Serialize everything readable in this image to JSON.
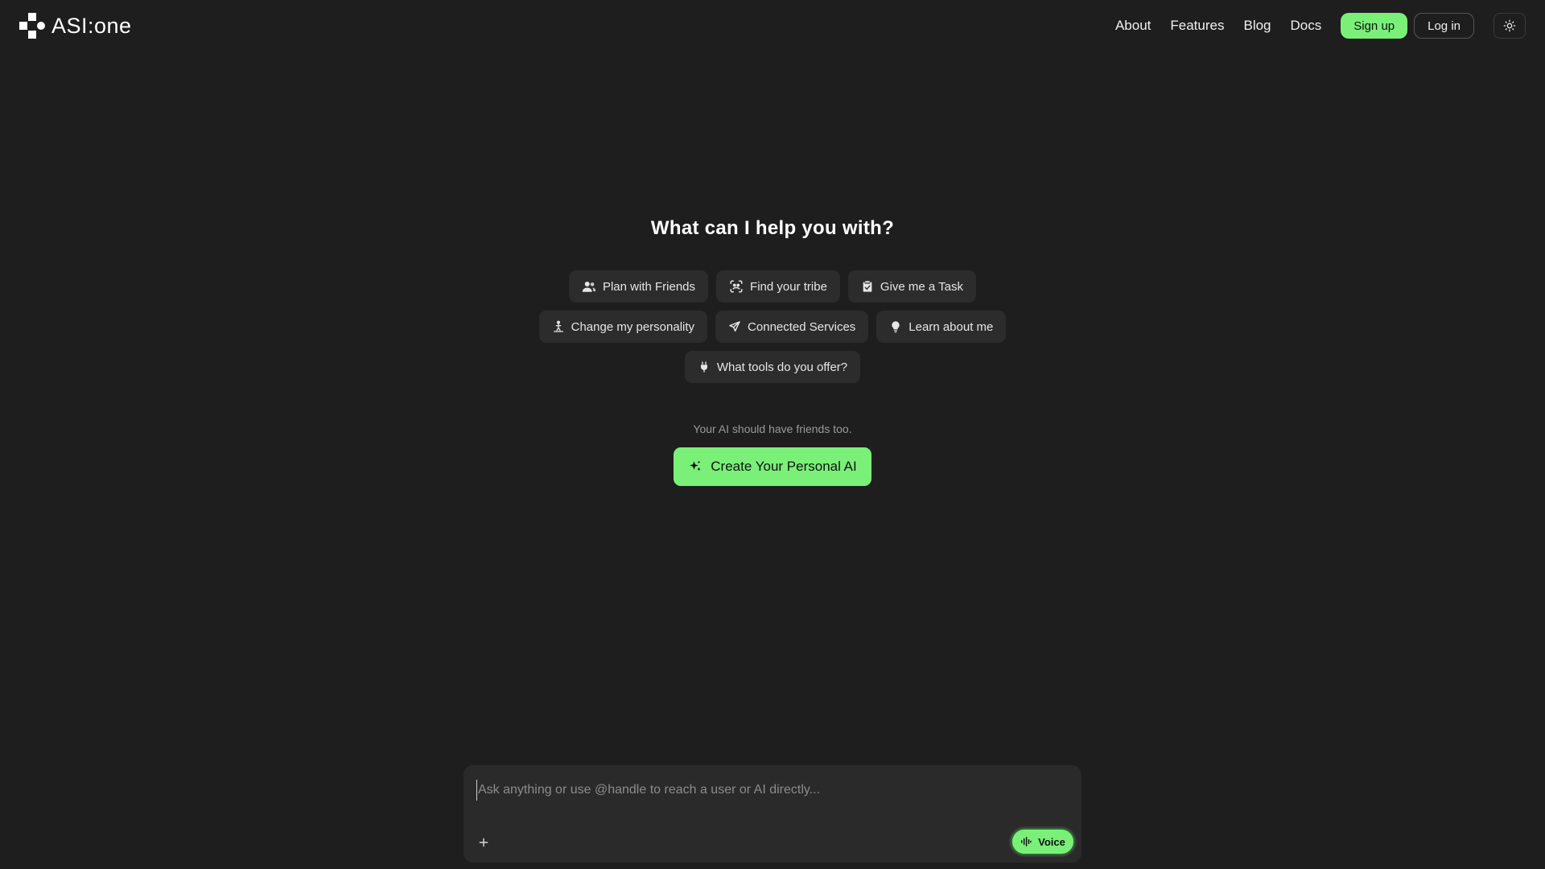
{
  "brand": {
    "name": "ASI:one"
  },
  "nav": {
    "links": [
      "About",
      "Features",
      "Blog",
      "Docs"
    ],
    "signup_label": "Sign up",
    "login_label": "Log in",
    "theme_icon": "sun-icon"
  },
  "main": {
    "heading": "What can I help you with?",
    "suggestions": [
      {
        "label": "Plan with Friends",
        "icon": "users-icon"
      },
      {
        "label": "Find your tribe",
        "icon": "scan-faces-icon"
      },
      {
        "label": "Give me a Task",
        "icon": "clipboard-check-icon"
      },
      {
        "label": "Change my personality",
        "icon": "person-standing-icon"
      },
      {
        "label": "Connected Services",
        "icon": "send-icon"
      },
      {
        "label": "Learn about me",
        "icon": "lightbulb-icon"
      },
      {
        "label": "What tools do you offer?",
        "icon": "plug-icon"
      }
    ],
    "tagline": "Your AI should have friends too.",
    "cta_label": "Create Your Personal AI"
  },
  "composer": {
    "placeholder": "Ask anything or use @handle to reach a user or AI directly...",
    "value": "",
    "voice_label": "Voice"
  },
  "colors": {
    "background": "#1e1e1e",
    "accent": "#7af078",
    "chip": "#2c2c2c",
    "composer": "#2a2a2a"
  }
}
